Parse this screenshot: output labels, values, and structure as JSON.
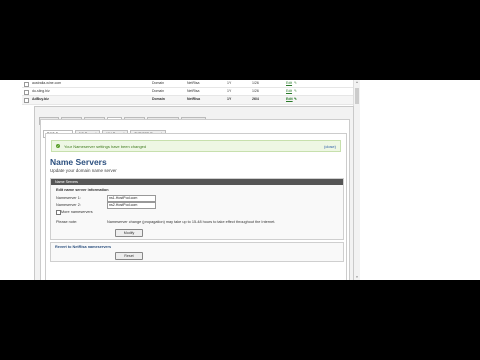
{
  "domains": [
    {
      "name": "australia-wine.com",
      "type": "Domain",
      "registrar": "NetRisa",
      "years": "1Y",
      "expires": "1/26",
      "edit": "Edit"
    },
    {
      "name": "du-sling.biz",
      "type": "Domain",
      "registrar": "NetRisa",
      "years": "1Y",
      "expires": "1/26",
      "edit": "Edit"
    },
    {
      "name": "AdBuy.biz",
      "type": "Domain",
      "registrar": "NetRisa",
      "years": "1Y",
      "expires": "26/4",
      "edit": "Edit",
      "selected": true
    }
  ],
  "tabs": [
    "Service",
    "Transfer",
    "Contact",
    "DNS",
    "Visibility",
    "Domain Expiry",
    "Sub-Resell"
  ],
  "active_tab": "DNS",
  "subtabs": [
    "DNS Servers",
    "NS Record",
    "MX Record",
    "TXT/SPF Record"
  ],
  "active_subtab": "DNS Servers",
  "notice": {
    "message": "Your Nameserver settings have been changed",
    "close": "(close)"
  },
  "page_title": "Name Servers",
  "page_subtitle": "Update your domain name server",
  "box": {
    "header": "Name Servers",
    "section_label": "Edit name server information",
    "ns1_label": "Nameserver 1:",
    "ns1_value": "ns1.HostPod.com",
    "ns2_label": "Nameserver 2:",
    "ns2_value": "ns2.HostPod.com",
    "more_label": "More nameservers",
    "note_label": "Please note:",
    "note_text": "Nameserver change (propagation) may take up to 15-48 hours to take effect throughout the Internet.",
    "modify_button": "Modify"
  },
  "reset_box": {
    "title": "Revert to NetRisa nameservers",
    "reset_button": "Reset"
  },
  "colors": {
    "title": "#2b4f7e",
    "notice_bg": "#eef7e4",
    "link": "#2a7a2a"
  }
}
